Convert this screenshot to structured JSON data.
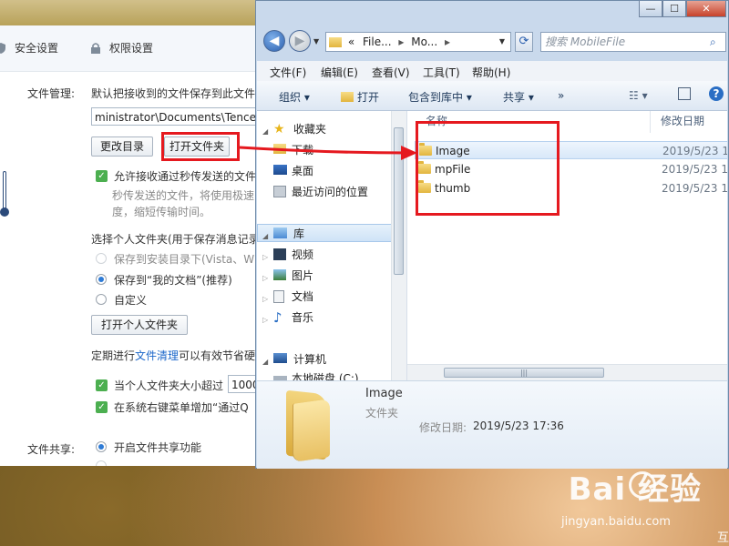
{
  "qq": {
    "tabs": [
      "安全设置",
      "权限设置"
    ],
    "file_manage_label": "文件管理:",
    "default_save_text": "默认把接收到的文件保存到此文件",
    "path_value": "ministrator\\Documents\\Tencen",
    "change_dir_button": "更改目录",
    "open_folder_button": "打开文件夹",
    "allow_second_transfer": "允许接收通过秒传发送的文件",
    "second_transfer_desc_1": "秒传发送的文件，将使用极速",
    "second_transfer_desc_2": "度，缩短传输时间。",
    "personal_folder_title": "选择个人文件夹(用于保存消息记录",
    "radio_install_dir": "保存到安装目录下(Vista、W",
    "radio_my_docs": "保存到“我的文档”(推荐)",
    "radio_custom": "自定义",
    "open_personal_folder_button": "打开个人文件夹",
    "cleanup_prefix": "定期进行",
    "cleanup_link": "文件清理",
    "cleanup_suffix": "可以有效节省硬",
    "size_exceed_label": "当个人文件夹大小超过",
    "size_value": "1000",
    "context_menu_label": "在系统右键菜单增加“通过Q",
    "file_share_label": "文件共享:",
    "enable_share_label": "开启文件共享功能"
  },
  "explorer": {
    "window_controls": [
      "—",
      "☐",
      "✕"
    ],
    "address": [
      "«",
      "File...",
      "▸",
      "Mo...",
      "▸"
    ],
    "search_placeholder": "搜索 MobileFile",
    "menu": [
      "文件(F)",
      "编辑(E)",
      "查看(V)",
      "工具(T)",
      "帮助(H)"
    ],
    "toolbar": {
      "organize": "组织 ▾",
      "open": "打开",
      "include_library": "包含到库中 ▾",
      "share": "共享 ▾",
      "more": "»"
    },
    "nav": {
      "favorites": "收藏夹",
      "favorites_items": [
        "下载",
        "桌面",
        "最近访问的位置"
      ],
      "libraries": "库",
      "library_items": [
        "视频",
        "图片",
        "文档",
        "音乐"
      ],
      "computer": "计算机",
      "computer_items": [
        "本地磁盘 (C:)"
      ]
    },
    "columns": {
      "name": "名称",
      "modified": "修改日期"
    },
    "files": [
      {
        "name": "Image",
        "date": "2019/5/23 17"
      },
      {
        "name": "mpFile",
        "date": "2019/5/23 17"
      },
      {
        "name": "thumb",
        "date": "2019/5/23 17"
      }
    ],
    "details": {
      "name": "Image",
      "type": "文件夹",
      "modified_label": "修改日期:",
      "modified_value": "2019/5/23 17:36"
    }
  },
  "watermark": {
    "brand": "Bai 经验",
    "url": "jingyan.baidu.com",
    "corner": "互"
  },
  "colors": {
    "annotation_red": "#e5191f",
    "link_blue": "#1a66c9",
    "check_green": "#4caf50"
  }
}
